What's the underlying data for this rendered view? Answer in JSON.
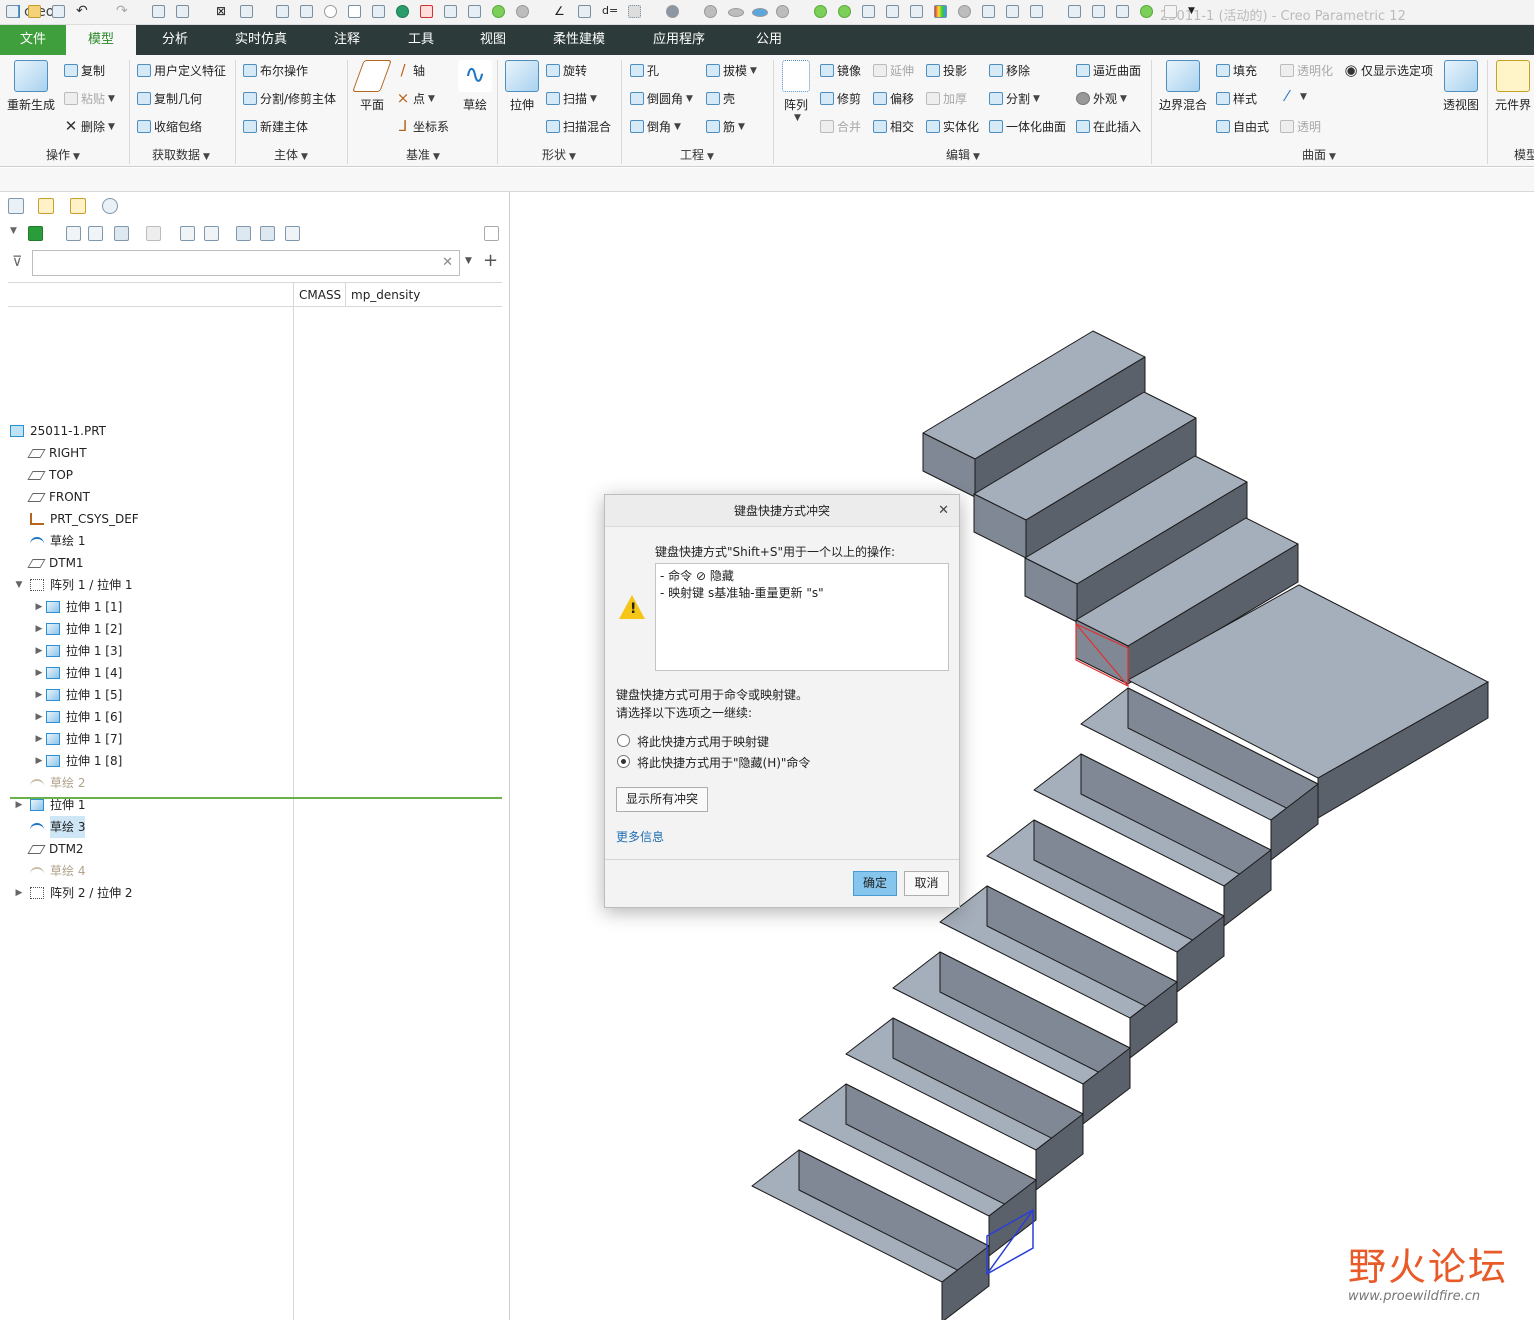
{
  "app": {
    "logo": "creo°",
    "window_title": "25011-1 (活动的) - Creo Parametric 12"
  },
  "menu": {
    "tabs": [
      "文件",
      "模型",
      "分析",
      "实时仿真",
      "注释",
      "工具",
      "视图",
      "柔性建模",
      "应用程序",
      "公用"
    ]
  },
  "ribbon": {
    "regen": "重新生成",
    "copy": "复制",
    "paste": "粘贴",
    "delete": "删除",
    "udf": "用户定义特征",
    "copy_geom": "复制几何",
    "shrinkwrap": "收缩包络",
    "boolean": "布尔操作",
    "split_trim": "分割/修剪主体",
    "new_body": "新建主体",
    "plane": "平面",
    "axis": "轴",
    "point": "点",
    "csys": "坐标系",
    "sketch": "草绘",
    "extrude": "拉伸",
    "revolve": "旋转",
    "sweep": "扫描",
    "swept_blend": "扫描混合",
    "hole": "孔",
    "draft": "拔模",
    "round": "倒圆角",
    "shell": "壳",
    "chamfer": "倒角",
    "rib": "筋",
    "pattern": "阵列",
    "mirror": "镜像",
    "extend": "延伸",
    "project": "投影",
    "move": "移除",
    "approx_surface": "逼近曲面",
    "trim": "修剪",
    "offset": "偏移",
    "thicken": "加厚",
    "split": "分割",
    "appearance": "外观",
    "merge": "合并",
    "intersect": "相交",
    "solidify": "实体化",
    "unify_surface": "一体化曲面",
    "insert_here": "在此插入",
    "boundary_blend": "边界混合",
    "fill": "填充",
    "style": "样式",
    "freestyle": "自由式",
    "transparency": "透明化",
    "show_selected": "仅显示选定项",
    "transparent": "透明",
    "see_through": "透视图",
    "component_interface": "元件界",
    "groups": {
      "ops": "操作",
      "get_data": "获取数据",
      "body": "主体",
      "datum": "基准",
      "shapes": "形状",
      "engineering": "工程",
      "editing": "编辑",
      "surfaces": "曲面",
      "model": "模型"
    }
  },
  "tree": {
    "columns": [
      "CMASS",
      "mp_density"
    ],
    "root": "25011-1.PRT",
    "items": [
      {
        "label": "RIGHT",
        "icon": "datum-plane-icon"
      },
      {
        "label": "TOP",
        "icon": "datum-plane-icon"
      },
      {
        "label": "FRONT",
        "icon": "datum-plane-icon"
      },
      {
        "label": "PRT_CSYS_DEF",
        "icon": "csys-icon"
      },
      {
        "label": "草绘 1",
        "icon": "sketch-icon"
      },
      {
        "label": "DTM1",
        "icon": "datum-plane-icon"
      },
      {
        "label": "阵列 1 / 拉伸 1",
        "icon": "pattern-icon"
      },
      {
        "label": "拉伸 1 [1]",
        "icon": "extrude-icon"
      },
      {
        "label": "拉伸 1 [2]",
        "icon": "extrude-icon"
      },
      {
        "label": "拉伸 1 [3]",
        "icon": "extrude-icon"
      },
      {
        "label": "拉伸 1 [4]",
        "icon": "extrude-icon"
      },
      {
        "label": "拉伸 1 [5]",
        "icon": "extrude-icon"
      },
      {
        "label": "拉伸 1 [6]",
        "icon": "extrude-icon"
      },
      {
        "label": "拉伸 1 [7]",
        "icon": "extrude-icon"
      },
      {
        "label": "拉伸 1 [8]",
        "icon": "extrude-icon"
      },
      {
        "label": "草绘 2",
        "icon": "sketch-icon"
      },
      {
        "label": "拉伸 1",
        "icon": "extrude-icon"
      },
      {
        "label": "草绘 3",
        "icon": "sketch-icon"
      },
      {
        "label": "DTM2",
        "icon": "datum-plane-icon"
      },
      {
        "label": "草绘 4",
        "icon": "sketch-icon"
      },
      {
        "label": "阵列 2 / 拉伸 2",
        "icon": "pattern-icon"
      }
    ]
  },
  "dialog": {
    "title": "键盘快捷方式冲突",
    "intro": "键盘快捷方式\"Shift+S\"用于一个以上的操作:",
    "conflict_prefix": "- 命令",
    "conflict_cmd": "隐藏",
    "conflict2": "- 映射键 s基准轴-重量更新 \"s\"",
    "explain1": "键盘快捷方式可用于命令或映射键。",
    "explain2": "请选择以下选项之一继续:",
    "option1": "将此快捷方式用于映射键",
    "option2": "将此快捷方式用于\"隐藏(H)\"命令",
    "show_all": "显示所有冲突",
    "more_info": "更多信息",
    "ok": "确定",
    "cancel": "取消"
  },
  "watermark": {
    "brand": "野火论坛",
    "url": "www.proewildfire.cn"
  },
  "colors": {
    "menubar": "#2d3a3a",
    "file_tab": "#3f9f3c",
    "model_top": "#a5aebb",
    "model_side": "#5b616b",
    "model_front": "#808895",
    "accent": "#4a9bd4"
  }
}
